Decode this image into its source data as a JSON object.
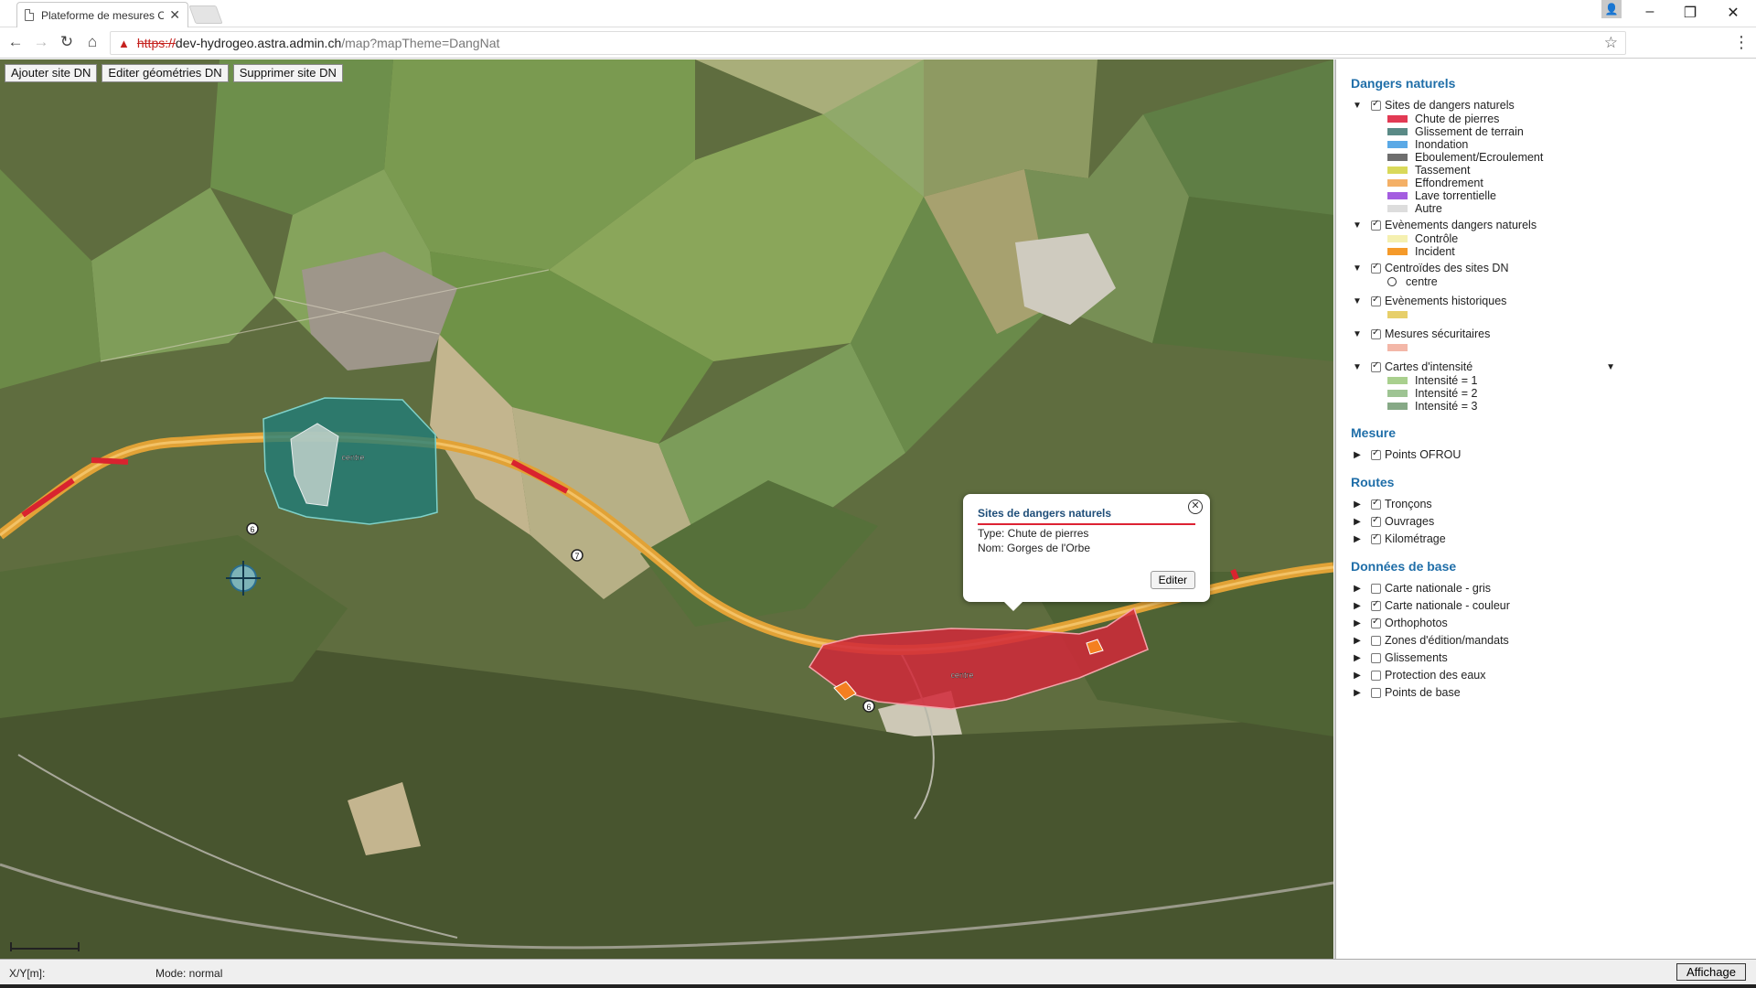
{
  "browser": {
    "tab_title": "Plateforme de mesures O",
    "url_scheme": "https://",
    "url_host": "dev-hydrogeo.astra.admin.ch",
    "url_path": "/map?mapTheme=DangNat"
  },
  "toolbar": {
    "add": "Ajouter site DN",
    "edit": "Editer géométries DN",
    "delete": "Supprimer site DN"
  },
  "map": {
    "label_centre_1": "centre",
    "label_centre_2": "centre",
    "marker_6a": "6",
    "marker_7": "7",
    "marker_6b": "6"
  },
  "popup": {
    "title": "Sites de dangers naturels",
    "type_line": "Type: Chute de pierres",
    "name_line": "Nom: Gorges de l'Orbe",
    "edit_label": "Editer"
  },
  "panel": {
    "dangers": {
      "title": "Dangers naturels",
      "sites": {
        "label": "Sites de dangers naturels",
        "items": [
          {
            "label": "Chute de pierres",
            "color": "#e23a54"
          },
          {
            "label": "Glissement de terrain",
            "color": "#5a8a86"
          },
          {
            "label": "Inondation",
            "color": "#5aa9e6"
          },
          {
            "label": "Eboulement/Ecroulement",
            "color": "#6e6e6e"
          },
          {
            "label": "Tassement",
            "color": "#d9d95a"
          },
          {
            "label": "Effondrement",
            "color": "#f4b066"
          },
          {
            "label": "Lave torrentielle",
            "color": "#a45de0"
          },
          {
            "label": "Autre",
            "color": "#dddddd"
          }
        ]
      },
      "events": {
        "label": "Evènements dangers naturels",
        "items": [
          {
            "label": "Contrôle",
            "color": "#f5f0b0"
          },
          {
            "label": "Incident",
            "color": "#f59a2a"
          }
        ]
      },
      "centroids": {
        "label": "Centroïdes des sites DN",
        "item": "centre"
      },
      "historic": {
        "label": "Evènements historiques",
        "color": "#e7cf6a"
      },
      "measures": {
        "label": "Mesures sécuritaires",
        "color": "#f3b7a8"
      },
      "intensity": {
        "label": "Cartes d'intensité",
        "items": [
          {
            "label": "Intensité = 1",
            "color": "#a9d08e"
          },
          {
            "label": "Intensité = 2",
            "color": "#9ec493"
          },
          {
            "label": "Intensité = 3",
            "color": "#86a986"
          }
        ]
      }
    },
    "mesure": {
      "title": "Mesure",
      "items": [
        "Points OFROU"
      ]
    },
    "routes": {
      "title": "Routes",
      "items": [
        "Tronçons",
        "Ouvrages",
        "Kilométrage"
      ]
    },
    "base": {
      "title": "Données de base",
      "items": [
        {
          "label": "Carte nationale - gris",
          "checked": false
        },
        {
          "label": "Carte nationale - couleur",
          "checked": true
        },
        {
          "label": "Orthophotos",
          "checked": true
        },
        {
          "label": "Zones d'édition/mandats",
          "checked": false
        },
        {
          "label": "Glissements",
          "checked": false
        },
        {
          "label": "Protection des eaux",
          "checked": false
        },
        {
          "label": "Points de base",
          "checked": false
        }
      ]
    }
  },
  "status": {
    "coords": "X/Y[m]:",
    "mode": "Mode: normal",
    "display_button": "Affichage"
  }
}
